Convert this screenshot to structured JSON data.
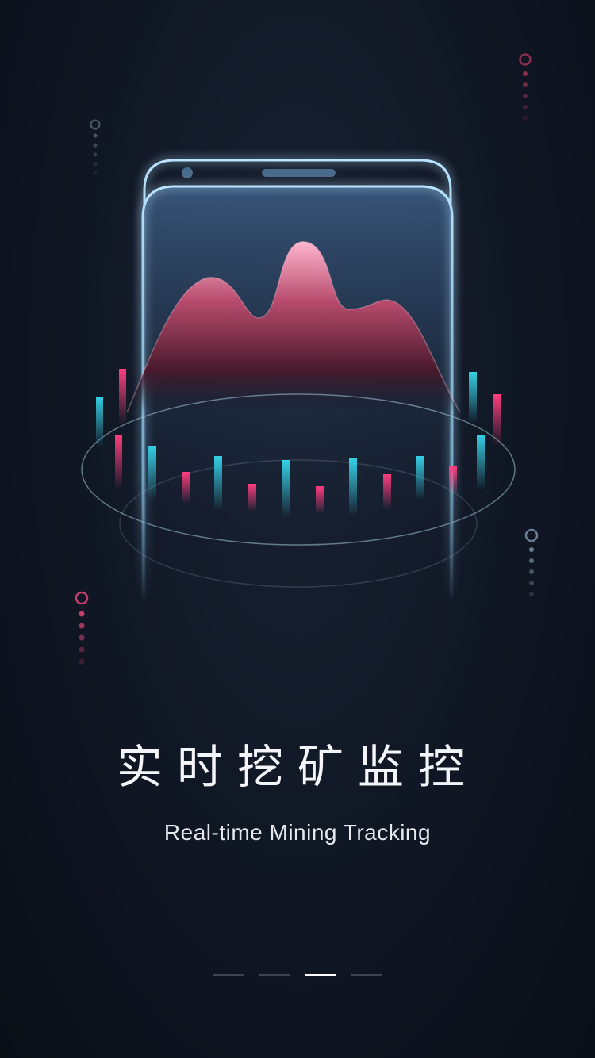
{
  "onboarding": {
    "title": "实时挖矿监控",
    "subtitle": "Real-time Mining Tracking",
    "page_indicator": {
      "total": 4,
      "active_index": 2
    }
  },
  "colors": {
    "background": "#0d121c",
    "phone_outline": "#9fd4f2",
    "pink_accent": "#e0447a",
    "cyan_accent": "#2ec4d8",
    "indicator_active": "#ffffff",
    "indicator_inactive": "#3d4452"
  },
  "icons": [
    "phone-illustration",
    "area-chart-icon",
    "candlestick-bars",
    "orbit-ring",
    "decorative-dot-column"
  ]
}
